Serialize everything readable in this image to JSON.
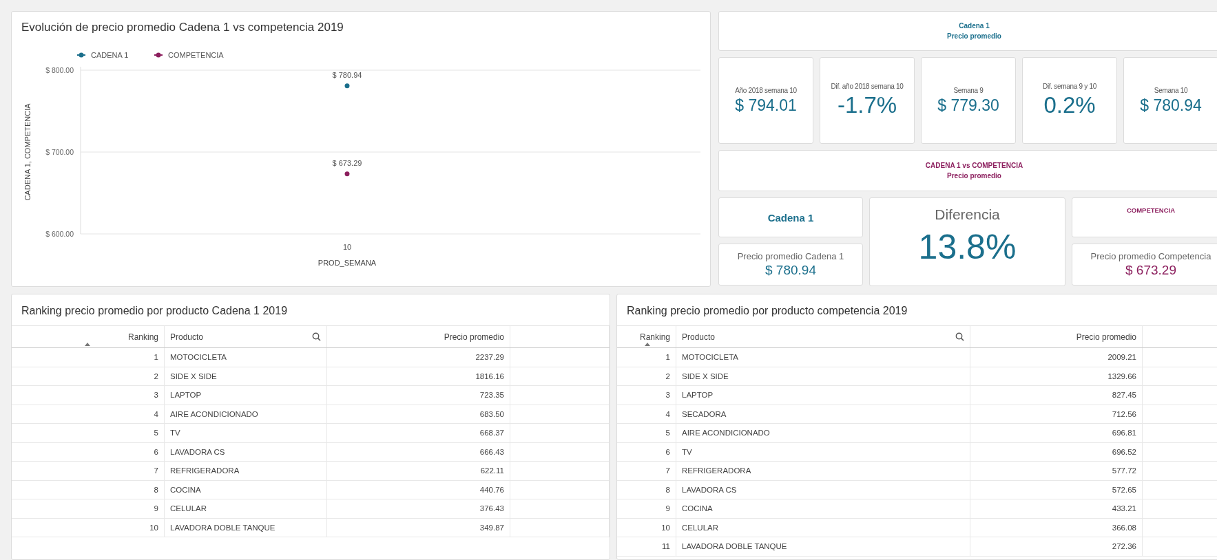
{
  "chart_panel": {
    "title": "Evolución de precio promedio Cadena 1 vs competencia 2019",
    "chart_data": {
      "type": "line",
      "xlabel": "PROD_SEMANA",
      "ylabel": "CADENA 1, COMPETENCIA",
      "categories": [
        "10"
      ],
      "legend": true,
      "series": [
        {
          "name": "CADENA 1",
          "color": "#1b6f8c",
          "marker": true,
          "values": [
            780.94
          ]
        },
        {
          "name": "COMPETENCIA",
          "color": "#8c1f5e",
          "marker": true,
          "values": [
            673.29
          ]
        }
      ],
      "ylim": [
        600,
        800
      ],
      "yticks": [
        {
          "value": 800,
          "label": "$ 800.00"
        },
        {
          "value": 700,
          "label": "$ 700.00"
        },
        {
          "value": 600,
          "label": "$ 600.00"
        }
      ],
      "value_labels": [
        "$ 780.94",
        "$ 673.29"
      ]
    }
  },
  "cadena_header": {
    "lines": [
      "Cadena 1",
      "Precio promedio"
    ]
  },
  "kpis": [
    {
      "label": "Año 2018 semana 10",
      "value": "$ 794.01",
      "kind": "amount"
    },
    {
      "label": "Dif. año 2018 semana 10",
      "value": "-1.7%",
      "kind": "percent"
    },
    {
      "label": "Semana 9",
      "value": "$ 779.30",
      "kind": "amount"
    },
    {
      "label": "Dif. semana 9 y 10",
      "value": "0.2%",
      "kind": "percent"
    },
    {
      "label": "Semana 10",
      "value": "$ 780.94",
      "kind": "amount"
    }
  ],
  "comparison_header": {
    "lines": [
      "CADENA 1 vs COMPETENCIA",
      "Precio promedio"
    ]
  },
  "cadena_card": {
    "title": "Cadena 1",
    "label": "Precio promedio Cadena 1",
    "value": "$ 780.94"
  },
  "difference_card": {
    "label": "Diferencia",
    "value": "13.8%"
  },
  "competencia_card": {
    "title": "COMPETENCIA",
    "label": "Precio promedio Competencia",
    "value": "$ 673.29"
  },
  "tables": [
    {
      "title": "Ranking precio promedio por producto Cadena 1 2019",
      "columns": [
        {
          "label": "Ranking",
          "sorted": true
        },
        {
          "label": "Producto",
          "sorted": false
        },
        {
          "label": "Precio promedio",
          "sorted": false
        }
      ],
      "rows": [
        [
          "1",
          "MOTOCICLETA",
          "2237.29"
        ],
        [
          "2",
          "SIDE X SIDE",
          "1816.16"
        ],
        [
          "3",
          "LAPTOP",
          "723.35"
        ],
        [
          "4",
          "AIRE ACONDICIONADO",
          "683.50"
        ],
        [
          "5",
          "TV",
          "668.37"
        ],
        [
          "6",
          "LAVADORA CS",
          "666.43"
        ],
        [
          "7",
          "REFRIGERADORA",
          "622.11"
        ],
        [
          "8",
          "COCINA",
          "440.76"
        ],
        [
          "9",
          "CELULAR",
          "376.43"
        ],
        [
          "10",
          "LAVADORA DOBLE TANQUE",
          "349.87"
        ]
      ]
    },
    {
      "title": "Ranking precio promedio por producto competencia 2019",
      "columns": [
        {
          "label": "Ranking",
          "sorted": true
        },
        {
          "label": "Producto",
          "sorted": false
        },
        {
          "label": "Precio promedio",
          "sorted": false
        }
      ],
      "rows": [
        [
          "1",
          "MOTOCICLETA",
          "2009.21"
        ],
        [
          "2",
          "SIDE X SIDE",
          "1329.66"
        ],
        [
          "3",
          "LAPTOP",
          "827.45"
        ],
        [
          "4",
          "SECADORA",
          "712.56"
        ],
        [
          "5",
          "AIRE ACONDICIONADO",
          "696.81"
        ],
        [
          "6",
          "TV",
          "696.52"
        ],
        [
          "7",
          "REFRIGERADORA",
          "577.72"
        ],
        [
          "8",
          "LAVADORA CS",
          "572.65"
        ],
        [
          "9",
          "COCINA",
          "433.21"
        ],
        [
          "10",
          "CELULAR",
          "366.08"
        ],
        [
          "11",
          "LAVADORA DOBLE TANQUE",
          "272.36"
        ]
      ]
    }
  ]
}
